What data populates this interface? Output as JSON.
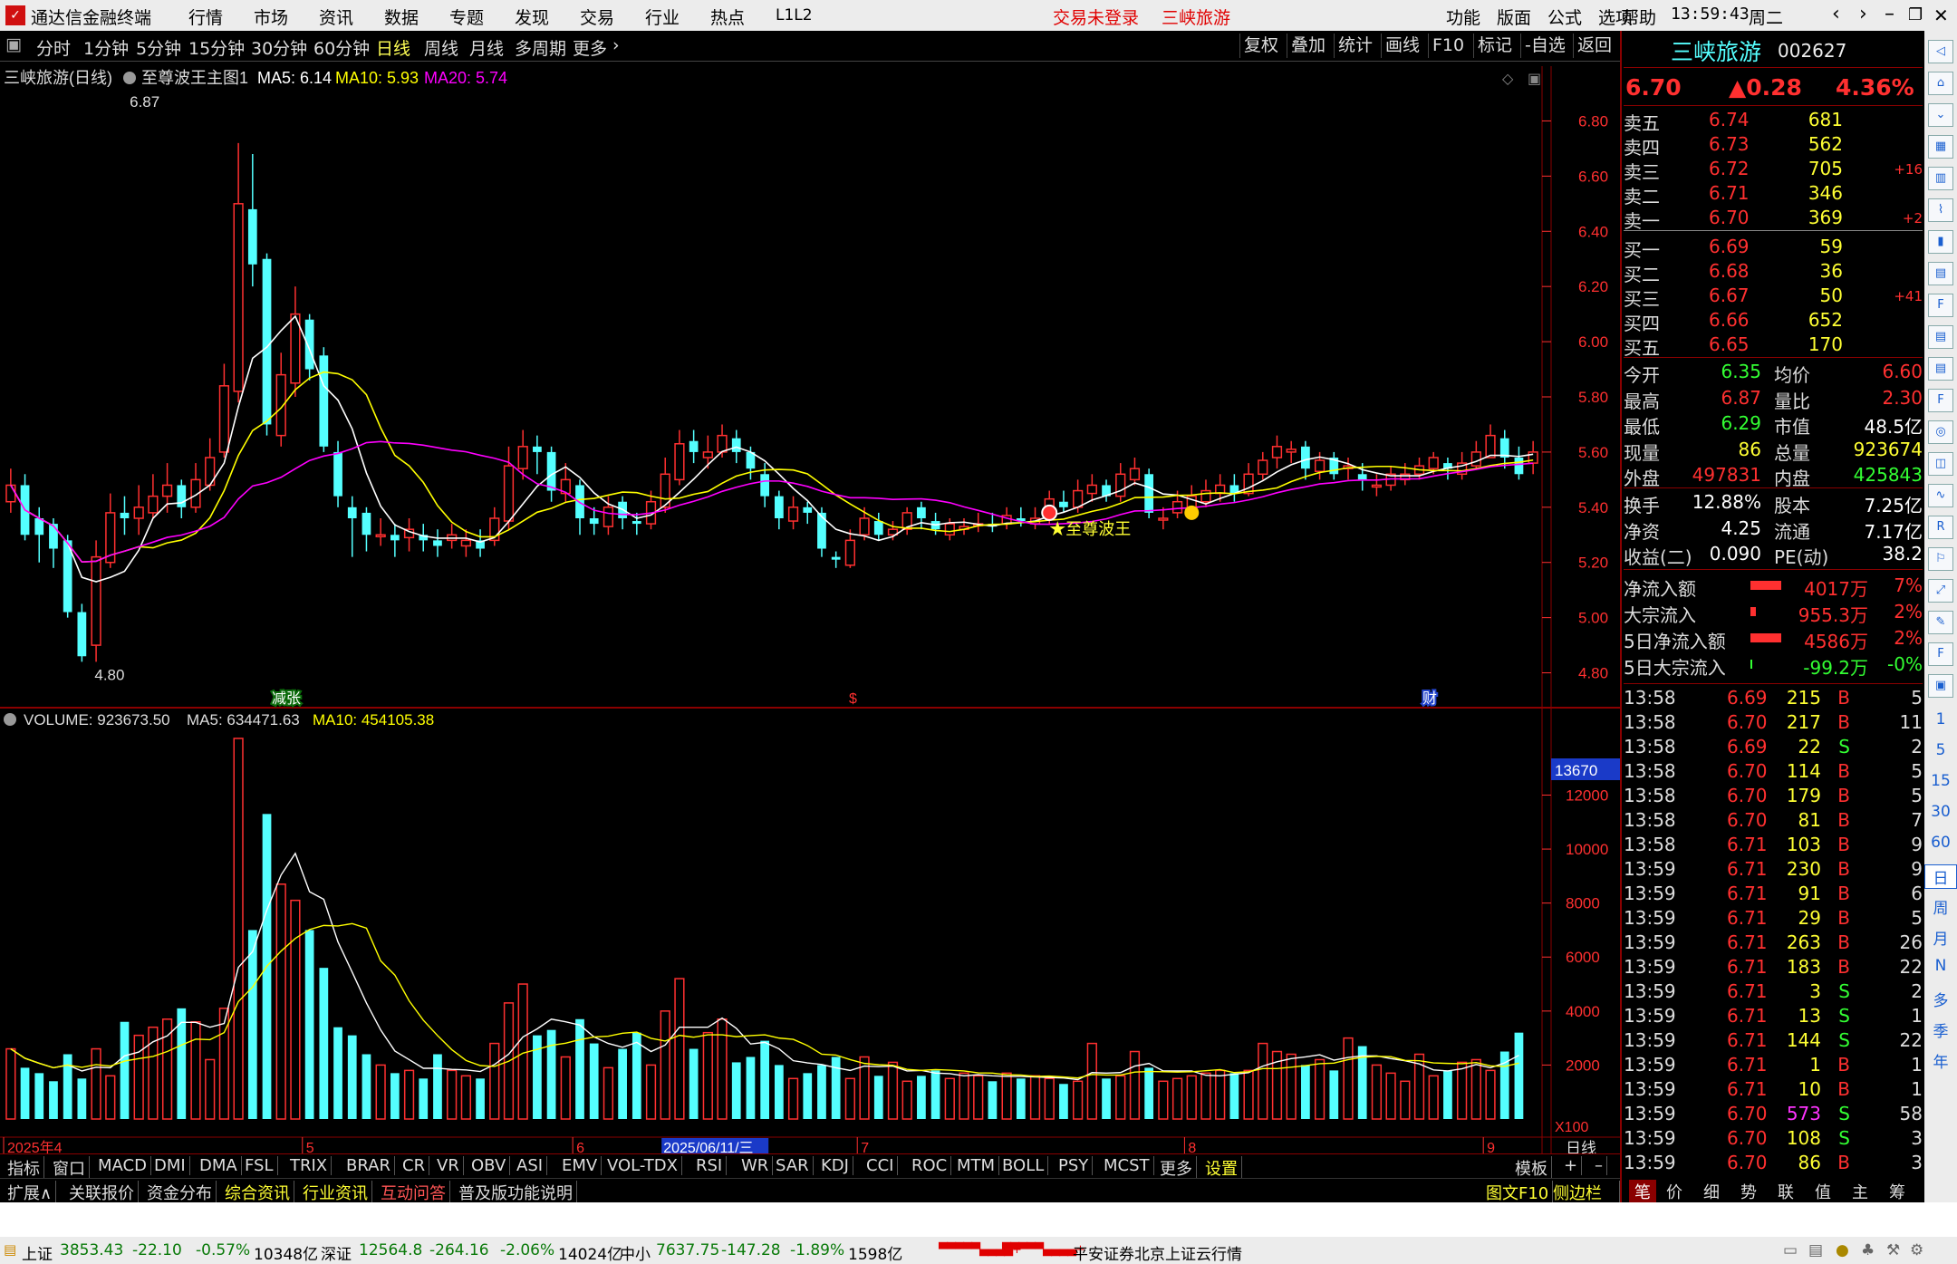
{
  "app": {
    "title": "通达信金融终端",
    "menu": [
      "行情",
      "市场",
      "资讯",
      "数据",
      "专题",
      "发现",
      "交易",
      "行业",
      "热点",
      "L1L2"
    ],
    "login_status": "交易未登录",
    "stock_tab": "三峡旅游",
    "right_menu": [
      "功能",
      "版面",
      "公式",
      "选项",
      "帮助"
    ],
    "time": "13:59:43",
    "weekday": "周二"
  },
  "periods": [
    "分时",
    "1分钟",
    "5分钟",
    "15分钟",
    "30分钟",
    "60分钟",
    "日线",
    "周线",
    "月线",
    "多周期",
    "更多"
  ],
  "active_period": "日线",
  "chart_tools": [
    "复权",
    "叠加",
    "统计",
    "画线",
    "F10",
    "标记",
    "-自选",
    "返回"
  ],
  "main_legend": {
    "name": "三峡旅游(日线)",
    "indicator": "至尊波王主图1",
    "ma5": "MA5: 6.14",
    "ma10": "MA10: 5.93",
    "ma20": "MA20: 5.74"
  },
  "colors": {
    "up": "#ff3030",
    "down": "#54ffff",
    "ma5": "#ffffff",
    "ma10": "#ffff00",
    "ma20": "#ff00ff",
    "grid": "#8a0000",
    "axis": "#ff3030"
  },
  "chart_data": {
    "type": "candlestick",
    "dates": [
      "2025-04-01",
      "2025-04-02",
      "2025-04-03",
      "2025-04-07",
      "2025-04-08",
      "2025-04-09",
      "2025-04-10",
      "2025-04-11",
      "2025-04-14",
      "2025-04-15",
      "2025-04-16",
      "2025-04-17",
      "2025-04-18",
      "2025-04-21",
      "2025-04-22",
      "2025-04-23",
      "2025-04-24",
      "2025-04-25",
      "2025-04-28",
      "2025-04-29",
      "2025-04-30",
      "2025-05-06",
      "2025-05-07",
      "2025-05-08",
      "2025-05-09",
      "2025-05-12",
      "2025-05-13",
      "2025-05-14",
      "2025-05-15",
      "2025-05-16",
      "2025-05-19",
      "2025-05-20",
      "2025-05-21",
      "2025-05-22",
      "2025-05-23",
      "2025-05-26",
      "2025-05-27",
      "2025-05-28",
      "2025-05-29",
      "2025-05-30",
      "2025-06-03",
      "2025-06-04",
      "2025-06-05",
      "2025-06-06",
      "2025-06-09",
      "2025-06-10",
      "2025-06-11",
      "2025-06-12",
      "2025-06-13",
      "2025-06-16",
      "2025-06-17",
      "2025-06-18",
      "2025-06-19",
      "2025-06-20",
      "2025-06-23",
      "2025-06-24",
      "2025-06-25",
      "2025-06-26",
      "2025-06-27",
      "2025-06-30",
      "2025-07-01",
      "2025-07-02",
      "2025-07-03",
      "2025-07-04",
      "2025-07-07",
      "2025-07-08",
      "2025-07-09",
      "2025-07-10",
      "2025-07-11",
      "2025-07-14",
      "2025-07-15",
      "2025-07-16",
      "2025-07-17",
      "2025-07-18",
      "2025-07-21",
      "2025-07-22",
      "2025-07-23",
      "2025-07-24",
      "2025-07-25",
      "2025-07-28",
      "2025-07-29",
      "2025-07-30",
      "2025-07-31",
      "2025-08-01",
      "2025-08-04",
      "2025-08-05",
      "2025-08-06",
      "2025-08-07",
      "2025-08-08",
      "2025-08-11",
      "2025-08-12",
      "2025-08-13",
      "2025-08-14",
      "2025-08-15",
      "2025-08-18",
      "2025-08-19",
      "2025-08-20",
      "2025-08-21",
      "2025-08-22",
      "2025-08-25",
      "2025-08-26",
      "2025-08-27",
      "2025-08-28",
      "2025-08-29",
      "2025-09-01",
      "2025-09-02"
    ],
    "open": [
      5.42,
      5.48,
      5.36,
      5.34,
      5.28,
      5.02,
      4.9,
      5.2,
      5.38,
      5.36,
      5.38,
      5.44,
      5.48,
      5.4,
      5.48,
      5.6,
      5.82,
      6.48,
      6.3,
      5.66,
      5.85,
      6.08,
      5.95,
      5.6,
      5.4,
      5.38,
      5.3,
      5.3,
      5.29,
      5.3,
      5.28,
      5.28,
      5.26,
      5.28,
      5.28,
      5.35,
      5.54,
      5.62,
      5.6,
      5.45,
      5.48,
      5.36,
      5.33,
      5.42,
      5.35,
      5.34,
      5.4,
      5.5,
      5.64,
      5.58,
      5.6,
      5.65,
      5.6,
      5.52,
      5.44,
      5.35,
      5.4,
      5.38,
      5.22,
      5.19,
      5.3,
      5.35,
      5.3,
      5.32,
      5.4,
      5.35,
      5.3,
      5.32,
      5.34,
      5.34,
      5.34,
      5.36,
      5.34,
      5.36,
      5.42,
      5.4,
      5.45,
      5.48,
      5.44,
      5.5,
      5.52,
      5.36,
      5.38,
      5.4,
      5.42,
      5.45,
      5.48,
      5.45,
      5.52,
      5.58,
      5.6,
      5.62,
      5.53,
      5.58,
      5.54,
      5.52,
      5.48,
      5.48,
      5.5,
      5.52,
      5.54,
      5.56,
      5.52,
      5.55,
      5.58,
      5.65,
      5.58,
      5.56
    ],
    "close": [
      5.48,
      5.3,
      5.3,
      5.25,
      5.02,
      4.86,
      5.22,
      5.38,
      5.36,
      5.4,
      5.44,
      5.48,
      5.4,
      5.5,
      5.58,
      5.84,
      6.5,
      6.28,
      5.7,
      5.88,
      6.1,
      5.9,
      5.62,
      5.44,
      5.36,
      5.3,
      5.3,
      5.28,
      5.32,
      5.28,
      5.26,
      5.3,
      5.28,
      5.25,
      5.36,
      5.55,
      5.62,
      5.6,
      5.46,
      5.5,
      5.36,
      5.34,
      5.4,
      5.36,
      5.34,
      5.42,
      5.52,
      5.63,
      5.6,
      5.6,
      5.66,
      5.6,
      5.54,
      5.44,
      5.36,
      5.4,
      5.38,
      5.25,
      5.21,
      5.28,
      5.36,
      5.3,
      5.32,
      5.38,
      5.36,
      5.32,
      5.34,
      5.33,
      5.34,
      5.33,
      5.37,
      5.35,
      5.36,
      5.43,
      5.4,
      5.46,
      5.48,
      5.44,
      5.52,
      5.54,
      5.38,
      5.36,
      5.42,
      5.44,
      5.46,
      5.48,
      5.45,
      5.52,
      5.57,
      5.62,
      5.61,
      5.54,
      5.57,
      5.52,
      5.55,
      5.5,
      5.48,
      5.52,
      5.52,
      5.55,
      5.58,
      5.54,
      5.56,
      5.6,
      5.66,
      5.58,
      5.52,
      5.6
    ],
    "high": [
      5.54,
      5.52,
      5.4,
      5.36,
      5.3,
      5.05,
      5.28,
      5.45,
      5.44,
      5.48,
      5.52,
      5.56,
      5.5,
      5.56,
      5.65,
      5.92,
      6.72,
      6.68,
      6.32,
      5.96,
      6.2,
      6.1,
      5.98,
      5.64,
      5.44,
      5.4,
      5.36,
      5.34,
      5.36,
      5.34,
      5.32,
      5.34,
      5.32,
      5.32,
      5.4,
      5.62,
      5.68,
      5.66,
      5.62,
      5.56,
      5.5,
      5.4,
      5.44,
      5.44,
      5.38,
      5.46,
      5.58,
      5.68,
      5.68,
      5.66,
      5.7,
      5.68,
      5.62,
      5.56,
      5.46,
      5.44,
      5.42,
      5.4,
      5.24,
      5.32,
      5.4,
      5.38,
      5.35,
      5.4,
      5.42,
      5.38,
      5.36,
      5.36,
      5.38,
      5.38,
      5.4,
      5.4,
      5.4,
      5.46,
      5.46,
      5.5,
      5.52,
      5.5,
      5.56,
      5.58,
      5.54,
      5.4,
      5.46,
      5.48,
      5.5,
      5.52,
      5.52,
      5.56,
      5.6,
      5.66,
      5.64,
      5.64,
      5.6,
      5.6,
      5.58,
      5.56,
      5.52,
      5.55,
      5.56,
      5.58,
      5.6,
      5.58,
      5.6,
      5.64,
      5.7,
      5.68,
      5.62,
      5.64
    ],
    "low": [
      5.38,
      5.28,
      5.2,
      5.18,
      5.0,
      4.84,
      4.84,
      5.18,
      5.3,
      5.3,
      5.36,
      5.38,
      5.36,
      5.38,
      5.46,
      5.58,
      5.78,
      6.2,
      5.66,
      5.62,
      5.8,
      5.86,
      5.6,
      5.4,
      5.22,
      5.24,
      5.26,
      5.22,
      5.24,
      5.24,
      5.22,
      5.25,
      5.22,
      5.22,
      5.26,
      5.32,
      5.5,
      5.52,
      5.42,
      5.42,
      5.3,
      5.3,
      5.3,
      5.32,
      5.3,
      5.32,
      5.38,
      5.48,
      5.56,
      5.54,
      5.58,
      5.56,
      5.5,
      5.4,
      5.32,
      5.32,
      5.34,
      5.22,
      5.18,
      5.18,
      5.28,
      5.28,
      5.28,
      5.3,
      5.32,
      5.3,
      5.28,
      5.3,
      5.31,
      5.31,
      5.32,
      5.33,
      5.32,
      5.34,
      5.38,
      5.38,
      5.42,
      5.42,
      5.42,
      5.48,
      5.36,
      5.32,
      5.36,
      5.38,
      5.4,
      5.42,
      5.42,
      5.44,
      5.5,
      5.54,
      5.56,
      5.5,
      5.5,
      5.5,
      5.5,
      5.46,
      5.44,
      5.46,
      5.48,
      5.5,
      5.52,
      5.5,
      5.5,
      5.54,
      5.58,
      5.54,
      5.5,
      5.52
    ],
    "volume": [
      2600,
      1900,
      1700,
      1400,
      2400,
      1500,
      2600,
      1600,
      3600,
      3100,
      3400,
      3700,
      4100,
      3600,
      2200,
      4100,
      14100,
      7000,
      11300,
      8700,
      8100,
      7000,
      5600,
      3400,
      3100,
      2400,
      2000,
      1700,
      1800,
      1500,
      2400,
      1800,
      1600,
      1500,
      2800,
      4300,
      5000,
      3100,
      3300,
      2300,
      3700,
      2800,
      1900,
      2600,
      3200,
      2000,
      4000,
      5200,
      2600,
      3200,
      3700,
      2100,
      2300,
      2900,
      2000,
      1500,
      1700,
      2000,
      2300,
      1500,
      2300,
      1600,
      2100,
      1400,
      1600,
      1800,
      1500,
      1700,
      1600,
      1400,
      1700,
      1500,
      1600,
      1500,
      1300,
      1400,
      2800,
      1500,
      1600,
      2500,
      1900,
      1400,
      1500,
      1600,
      1700,
      1800,
      1700,
      1800,
      2800,
      2500,
      2400,
      2000,
      2200,
      1800,
      3000,
      2700,
      2000,
      1700,
      1400,
      2400,
      1600,
      1800,
      2100,
      2200,
      1800,
      2500,
      3200
    ],
    "ylim": [
      4.7,
      6.9
    ],
    "yticks": [
      "6.80",
      "6.60",
      "6.40",
      "6.20",
      "6.00",
      "5.80",
      "5.60",
      "5.40",
      "5.20",
      "5.00",
      "4.80"
    ],
    "vol_yticks": [
      "12000",
      "10000",
      "8000",
      "6000",
      "4000",
      "2000"
    ],
    "vol_ylim": [
      0,
      14500
    ],
    "high_marker": "6.87",
    "low_marker": "4.80",
    "x_labels": [
      "2025年4",
      "5",
      "6",
      "7",
      "8",
      "9"
    ],
    "x_label_dates": [
      "2025-04-01",
      "2025-05-06",
      "2025-06-03",
      "2025-07-01",
      "2025-08-01",
      "2025-09-01"
    ],
    "selected_date_label": "2025/06/11/三",
    "signal_label": "★至尊波王",
    "event_markers": [
      "减张",
      "$",
      "财"
    ],
    "vol_legend": {
      "title": "VOLUME: 923673.50",
      "ma5": "MA5: 634471.63",
      "ma10": "MA10: 454105.38"
    },
    "vol_cursor": "13670",
    "vol_unit": "X100",
    "period_tag": "日线"
  },
  "quote": {
    "name": "三峡旅游",
    "code": "002627",
    "price": "6.70",
    "change": "▲0.28",
    "pct": "4.36%",
    "asks": [
      {
        "l": "卖五",
        "p": "6.74",
        "v": "681",
        "d": ""
      },
      {
        "l": "卖四",
        "p": "6.73",
        "v": "562",
        "d": ""
      },
      {
        "l": "卖三",
        "p": "6.72",
        "v": "705",
        "d": "+16"
      },
      {
        "l": "卖二",
        "p": "6.71",
        "v": "346",
        "d": ""
      },
      {
        "l": "卖一",
        "p": "6.70",
        "v": "369",
        "d": "+2"
      }
    ],
    "bids": [
      {
        "l": "买一",
        "p": "6.69",
        "v": "59",
        "d": ""
      },
      {
        "l": "买二",
        "p": "6.68",
        "v": "36",
        "d": ""
      },
      {
        "l": "买三",
        "p": "6.67",
        "v": "50",
        "d": "+41"
      },
      {
        "l": "买四",
        "p": "6.66",
        "v": "652",
        "d": ""
      },
      {
        "l": "买五",
        "p": "6.65",
        "v": "170",
        "d": ""
      }
    ],
    "stats1": [
      [
        "今开",
        "6.35",
        "均价",
        "6.60"
      ],
      [
        "最高",
        "6.87",
        "量比",
        "2.30"
      ],
      [
        "最低",
        "6.29",
        "市值",
        "48.5亿"
      ],
      [
        "现量",
        "86",
        "总量",
        "923674"
      ],
      [
        "外盘",
        "497831",
        "内盘",
        "425843"
      ]
    ],
    "stats2": [
      [
        "换手",
        "12.88%",
        "股本",
        "7.25亿"
      ],
      [
        "净资",
        "4.25",
        "流通",
        "7.17亿"
      ],
      [
        "收益(二)",
        "0.090",
        "PE(动)",
        "38.2"
      ]
    ],
    "flows": [
      [
        "净流入额",
        "4017万",
        "7%"
      ],
      [
        "大宗流入",
        "955.3万",
        "2%"
      ],
      [
        "5日净流入额",
        "4586万",
        "2%"
      ],
      [
        "5日大宗流入",
        "-99.2万",
        "-0%"
      ]
    ],
    "ticks": [
      [
        "13:58",
        "6.69",
        "215",
        "B",
        "5"
      ],
      [
        "13:58",
        "6.70",
        "217",
        "B",
        "11"
      ],
      [
        "13:58",
        "6.69",
        "22",
        "S",
        "2"
      ],
      [
        "13:58",
        "6.70",
        "114",
        "B",
        "5"
      ],
      [
        "13:58",
        "6.70",
        "179",
        "B",
        "5"
      ],
      [
        "13:58",
        "6.70",
        "81",
        "B",
        "7"
      ],
      [
        "13:58",
        "6.71",
        "103",
        "B",
        "9"
      ],
      [
        "13:59",
        "6.71",
        "230",
        "B",
        "9"
      ],
      [
        "13:59",
        "6.71",
        "91",
        "B",
        "6"
      ],
      [
        "13:59",
        "6.71",
        "29",
        "B",
        "5"
      ],
      [
        "13:59",
        "6.71",
        "263",
        "B",
        "26"
      ],
      [
        "13:59",
        "6.71",
        "183",
        "B",
        "22"
      ],
      [
        "13:59",
        "6.71",
        "3",
        "S",
        "2"
      ],
      [
        "13:59",
        "6.71",
        "13",
        "S",
        "1"
      ],
      [
        "13:59",
        "6.71",
        "144",
        "S",
        "22"
      ],
      [
        "13:59",
        "6.71",
        "1",
        "B",
        "1"
      ],
      [
        "13:59",
        "6.71",
        "10",
        "B",
        "1"
      ],
      [
        "13:59",
        "6.70",
        "573",
        "S",
        "58"
      ],
      [
        "13:59",
        "6.70",
        "108",
        "S",
        "3"
      ],
      [
        "13:59",
        "6.70",
        "86",
        "B",
        "3"
      ]
    ]
  },
  "indicator_tabs": [
    "指标",
    "窗口",
    "MACD",
    "DMI",
    "DMA",
    "FSL",
    "TRIX",
    "BRAR",
    "CR",
    "VR",
    "OBV",
    "ASI",
    "EMV",
    "VOL-TDX",
    "RSI",
    "WR",
    "SAR",
    "KDJ",
    "CCI",
    "ROC",
    "MTM",
    "BOLL",
    "PSY",
    "MCST",
    "更多",
    "设置"
  ],
  "template_label": "模板",
  "bottom_tabs": [
    "扩展∧",
    "关联报价",
    "资金分布",
    "综合资讯",
    "行业资讯",
    "互动问答",
    "普及版功能说明"
  ],
  "bottom_right": [
    "图文F10",
    "侧边栏《"
  ],
  "right_tabs": [
    "笔",
    "价",
    "细",
    "势",
    "联",
    "值",
    "主",
    "筹"
  ],
  "sidebar_periods": [
    "1",
    "5",
    "15",
    "30",
    "60",
    "日",
    "周",
    "月",
    "N",
    "多",
    "季",
    "年"
  ],
  "status": {
    "sh_name": "上证",
    "sh_val": "3853.43",
    "sh_chg": "-22.10",
    "sh_pct": "-0.57%",
    "sh_amt": "10348亿",
    "sz_name": "深证",
    "sz_val": "12564.8",
    "sz_chg": "-264.16",
    "sz_pct": "-2.06%",
    "sz_amt": "14024亿",
    "zx_name": "中小",
    "zx_val": "7637.75",
    "zx_chg": "-147.28",
    "zx_pct": "-1.89%",
    "zx_amt": "1598亿",
    "server": "平安证券北京上证云行情"
  }
}
